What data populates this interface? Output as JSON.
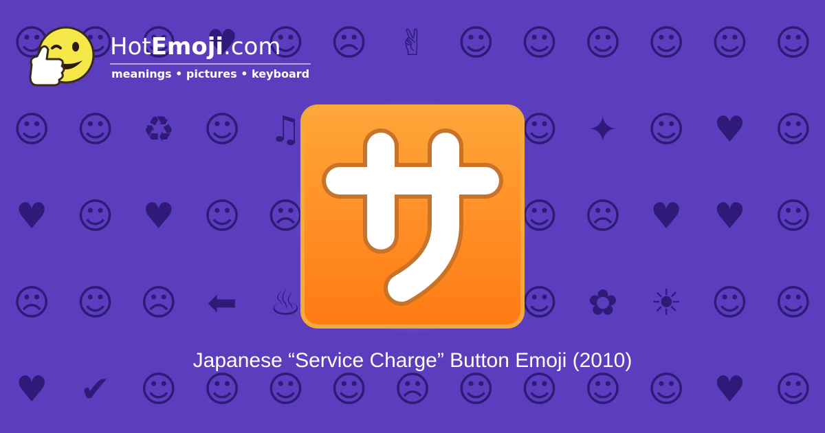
{
  "site": {
    "name_prefix": "Hot",
    "name_strong": "Emoji",
    "name_suffix": ".com",
    "tagline": "meanings • pictures • keyboard"
  },
  "emoji": {
    "glyph": "サ",
    "gradient_top": "#ffa63a",
    "gradient_bottom": "#ff7a12",
    "border_color": "#f5a83c"
  },
  "caption": "Japanese “Service Charge” Button Emoji (2010)",
  "colors": {
    "background": "#5b3dbd",
    "pattern": "#2e1a78"
  },
  "background_icons": [
    "☺",
    "☺",
    "☺",
    "♥",
    "☺",
    "☹",
    "✌",
    "☺",
    "☺",
    "☺",
    "☺",
    "☺",
    "☺",
    "☺",
    "☺",
    "♻",
    "☺",
    "♫",
    "☺",
    "☺",
    "☺",
    "☺",
    "✦",
    "☺",
    "♥",
    "☺",
    "♥",
    "☺",
    "♥",
    "☺",
    "☹",
    "☺",
    "☺",
    "♥",
    "☺",
    "☹",
    "♥",
    "♥",
    "☺",
    "☹",
    "☺",
    "☹",
    "⬅",
    "♨",
    "☺",
    "☺",
    "☺",
    "☺",
    "✿",
    "☀",
    "☺",
    "☺",
    "♥",
    "✔",
    "☺",
    "☺",
    "☺",
    "☺",
    "☹",
    "☺",
    "☺",
    "☺",
    "☺",
    "♥",
    "☺"
  ]
}
